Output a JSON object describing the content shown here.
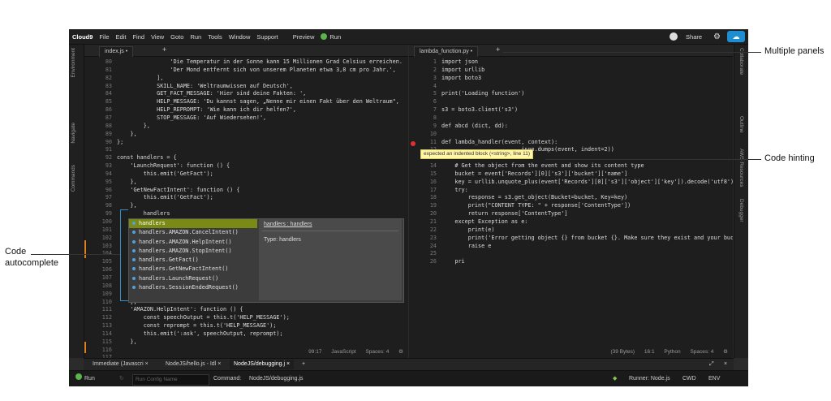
{
  "menu": {
    "logo": "Cloud9",
    "items": [
      "File",
      "Edit",
      "Find",
      "View",
      "Goto",
      "Run",
      "Tools",
      "Window",
      "Support"
    ],
    "preview": "Preview",
    "run": "Run",
    "share": "Share"
  },
  "left_tabs": [
    "Environment",
    "Navigate",
    "Commands"
  ],
  "right_tabs": [
    "Collaborate",
    "Outline",
    "AWS Resources",
    "Debugger"
  ],
  "left_pane": {
    "tab": "index.js",
    "line_numbers": [
      "80",
      "81",
      "82",
      "83",
      "84",
      "85",
      "86",
      "87",
      "88",
      "89",
      "90",
      "91",
      "92",
      "93",
      "94",
      "95",
      "96",
      "97",
      "98",
      "99",
      "100",
      "101",
      "102",
      "103",
      "104",
      "105",
      "106",
      "107",
      "108",
      "109",
      "110",
      "111",
      "112",
      "113",
      "114",
      "115",
      "116",
      "117"
    ],
    "lines": [
      "                'Die Temperatur in der Sonne kann 15 Millionen Grad Celsius erreichen.",
      "                'Der Mond entfernt sich von unserem Planeten etwa 3,8 cm pro Jahr.',",
      "            ],",
      "            SKILL_NAME: 'Weltraumwissen auf Deutsch',",
      "            GET_FACT_MESSAGE: 'Hier sind deine Fakten: ',",
      "            HELP_MESSAGE: 'Du kannst sagen, „Nenne mir einen Fakt über den Weltraum\",",
      "            HELP_REPROMPT: 'Wie kann ich dir helfen?',",
      "            STOP_MESSAGE: 'Auf Wiedersehen!',",
      "        },",
      "    },",
      "};",
      "",
      "const handlers = {",
      "    'LaunchRequest': function () {",
      "        this.emit('GetFact');",
      "    },",
      "    'GetNewFactIntent': function () {",
      "        this.emit('GetFact');",
      "    },",
      "        handlers",
      "    },",
      "",
      "",
      "",
      "",
      "",
      "",
      "",
      "",
      "        this.emit(':tellWithCard', speechOutput, this.t('SKILL_NAME'), randomFact);",
      "    },",
      "    'AMAZON.HelpIntent': function () {",
      "        const speechOutput = this.t('HELP_MESSAGE');",
      "        const reprompt = this.t('HELP_MESSAGE');",
      "        this.emit(':ask', speechOutput, reprompt);",
      "    },",
      "    'AMAZON.CancelIntent': function () {",
      ""
    ],
    "status": {
      "pos": "99:17",
      "lang": "JavaScript",
      "spaces": "Spaces: 4"
    }
  },
  "autocomplete": {
    "items": [
      "handlers",
      "handlers.AMAZON.CancelIntent()",
      "handlers.AMAZON.HelpIntent()",
      "handlers.AMAZON.StopIntent()",
      "handlers.GetFact()",
      "handlers.GetNewFactIntent()",
      "handlers.LaunchRequest()",
      "handlers.SessionEndedRequest()"
    ],
    "doc_title": "handlers : handlers",
    "doc_type": "Type: handlers"
  },
  "right_pane": {
    "tab": "lambda_function.py",
    "line_numbers": [
      "1",
      "2",
      "3",
      "4",
      "5",
      "6",
      "7",
      "8",
      "9",
      "10",
      "11",
      "12",
      "13",
      "14",
      "15",
      "16",
      "17",
      "18",
      "19",
      "20",
      "21",
      "22",
      "23",
      "24",
      "25",
      "26"
    ],
    "lines": [
      "import json",
      "import urllib",
      "import boto3",
      "",
      "print('Loading function')",
      "",
      "s3 = boto3.client('s3')",
      "",
      "def abcd (dict, dd):",
      "",
      "def lambda_handler(event, context):",
      "                        json.dumps(event, indent=2))",
      "",
      "    # Get the object from the event and show its content type",
      "    bucket = event['Records'][0]['s3']['bucket']['name']",
      "    key = urllib.unquote_plus(event['Records'][0]['s3']['object']['key']).decode('utf8')",
      "    try:",
      "        response = s3.get_object(Bucket=bucket, Key=key)",
      "        print(\"CONTENT TYPE: \" + response['ContentType'])",
      "        return response['ContentType']",
      "    except Exception as e:",
      "        print(e)",
      "        print('Error getting object {} from bucket {}. Make sure they exist and your bucket",
      "        raise e",
      "",
      "    pri"
    ],
    "hint": "expected an indented block (<string>, line 11)",
    "status": {
      "size": "(39 Bytes)",
      "pos": "16:1",
      "lang": "Python",
      "spaces": "Spaces: 4"
    }
  },
  "bottom_tabs": [
    "Immediate (Javascri ×",
    "NodeJS/hello.js - Idl ×",
    "NodeJS/debugging.j ×"
  ],
  "runbar": {
    "run": "Run",
    "config_placeholder": "Run Config Name",
    "command_label": "Command:",
    "command_value": "NodeJS/debugging.js",
    "runner": "Runner: Node.js",
    "cwd": "CWD",
    "env": "ENV"
  },
  "annotations": {
    "multiple_panels": "Multiple panels",
    "code_hinting": "Code hinting",
    "code_autocomplete_1": "Code",
    "code_autocomplete_2": "autocomplete"
  }
}
